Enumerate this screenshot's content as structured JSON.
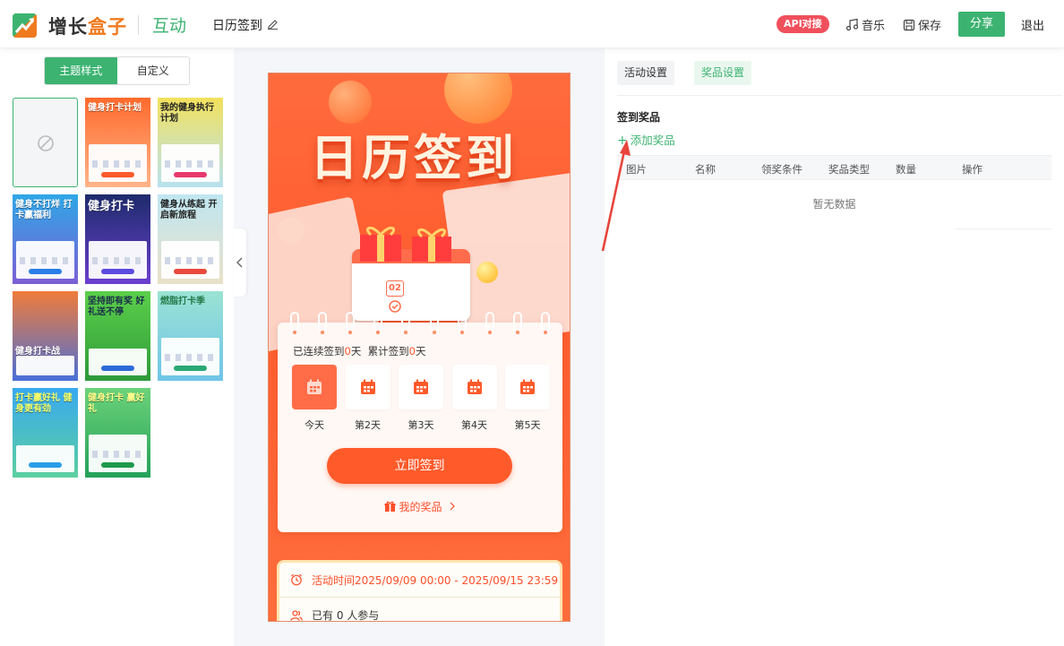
{
  "header": {
    "brand_a": "增长",
    "brand_b": "盒子",
    "module": "互动",
    "activity_title": "日历签到",
    "api_badge": "API对接",
    "music": "音乐",
    "save": "保存",
    "share": "分享",
    "logout": "退出",
    "colors": {
      "accent": "#3cb371",
      "badge": "#f0505b"
    }
  },
  "left_panel": {
    "tabs": [
      "主题样式",
      "自定义"
    ],
    "active_tab": 0,
    "themes": [
      {
        "title": "",
        "icon": "no-theme-icon"
      },
      {
        "title": "健身打卡计划"
      },
      {
        "title": "我的健身执行计划"
      },
      {
        "title": "健身不打烊 打卡赢福利"
      },
      {
        "title": "健身打卡"
      },
      {
        "title": "健身从练起 开启新旅程"
      },
      {
        "title": "健身打卡战"
      },
      {
        "title": "坚持即有奖 好礼送不停"
      },
      {
        "title": "燃脂打卡季"
      },
      {
        "title": "打卡赢好礼 健身更有劲"
      },
      {
        "title": "健身打卡 赢好礼"
      }
    ]
  },
  "preview": {
    "hero_title": "日历签到",
    "calendar_date": "02",
    "streak": {
      "label_a": "已连续签到",
      "value_a": "0",
      "unit_a": "天",
      "label_b": "累计签到",
      "value_b": "0",
      "unit_b": "天"
    },
    "days": [
      "今天",
      "第2天",
      "第3天",
      "第4天",
      "第5天"
    ],
    "sign_button": "立即签到",
    "my_prize": "我的奖品",
    "activity_time": "活动时间2025/09/09 00:00 - 2025/09/15 23:59",
    "participants": "已有 0 人参与",
    "colors": {
      "primary": "#ff5a2a"
    }
  },
  "settings": {
    "tabs": [
      "活动设置",
      "奖品设置"
    ],
    "active_tab": 1,
    "section_title": "签到奖品",
    "add_prize": "添加奖品",
    "columns": [
      "图片",
      "名称",
      "领奖条件",
      "奖品类型",
      "数量",
      "操作"
    ],
    "empty_text": "暂无数据"
  }
}
